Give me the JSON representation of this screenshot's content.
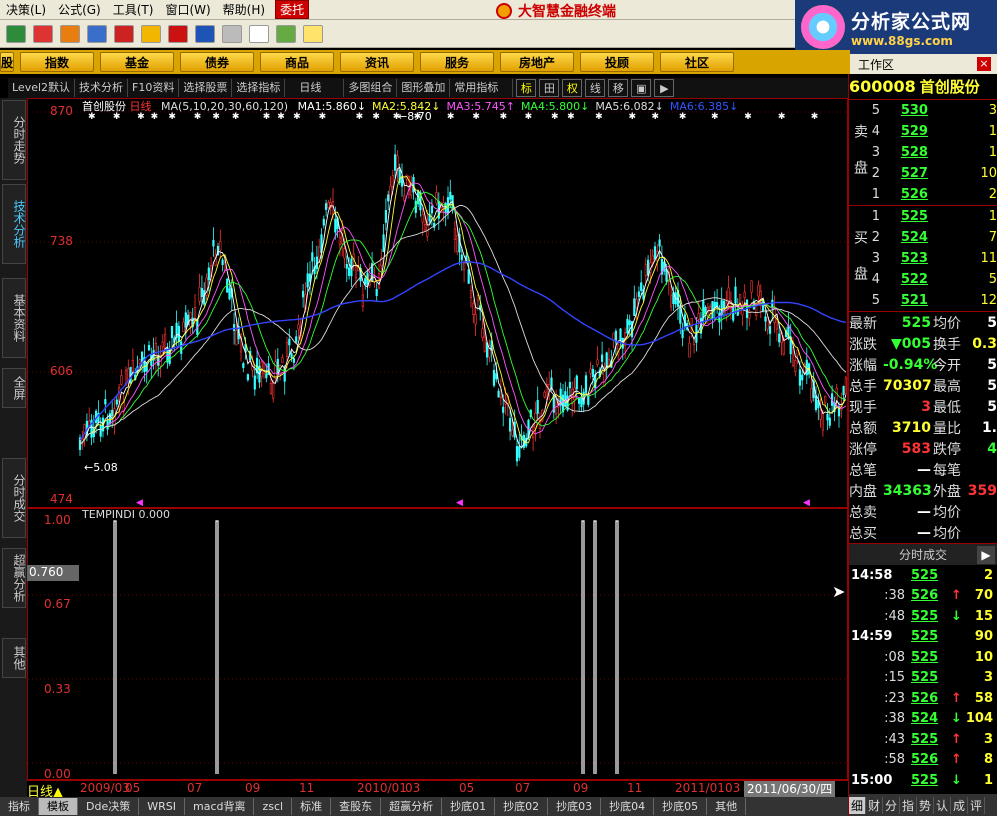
{
  "menu": {
    "items": [
      "决策(L)",
      "公式(G)",
      "工具(T)",
      "窗口(W)",
      "帮助(H)"
    ],
    "trade_label": "委托",
    "app_title": "大智慧金融终端"
  },
  "brand": {
    "name": "分析家公式网",
    "url": "www.88gs.com"
  },
  "section_nav": [
    "股",
    "指数",
    "基金",
    "债券",
    "商品",
    "资讯",
    "服务",
    "房地产",
    "投顾",
    "社区"
  ],
  "workarea_label": "工作区",
  "chart_toolbar": {
    "items": [
      "Level2默认",
      "技术分析",
      "F10资料",
      "选择股票",
      "选择指标",
      "日线",
      "多图组合",
      "图形叠加",
      "常用指标"
    ],
    "buttons": [
      "标",
      "田",
      "权",
      "线",
      "移"
    ]
  },
  "left_tabs": [
    "分时走势",
    "技术分析",
    "基本资料",
    "全屏",
    "分时成交",
    "超赢分析",
    "其他"
  ],
  "price_header": {
    "name": "首创股份",
    "period": "日线",
    "ma_label": "MA(5,10,20,30,60,120)",
    "ma": [
      {
        "label": "MA1:",
        "value": "5.860",
        "arrow": "↓",
        "color": "#ffffff"
      },
      {
        "label": "MA2:",
        "value": "5.842",
        "arrow": "↓",
        "color": "#ffff33"
      },
      {
        "label": "MA3:",
        "value": "5.745",
        "arrow": "↑",
        "color": "#ff55ff"
      },
      {
        "label": "MA4:",
        "value": "5.800",
        "arrow": "↓",
        "color": "#33ff33"
      },
      {
        "label": "MA5:",
        "value": "6.082",
        "arrow": "↓",
        "color": "#dddddd"
      },
      {
        "label": "MA6:",
        "value": "6.385",
        "arrow": "↓",
        "color": "#3355ff"
      }
    ]
  },
  "price_axis": [
    "870",
    "738",
    "606",
    "474"
  ],
  "price_annotations": {
    "high": "8.70",
    "low": "5.08"
  },
  "indicator": {
    "name": "TEMPINDI",
    "value": "0.000",
    "axis": [
      "1.00",
      "0.67",
      "0.33",
      "0.00"
    ],
    "cursor_value": "0.760"
  },
  "date_strip": {
    "period_label": "日线",
    "dates": [
      "2009/03",
      "05",
      "07",
      "09",
      "11",
      "2010/01",
      "03",
      "05",
      "07",
      "09",
      "11",
      "2011/01",
      "03"
    ],
    "cursor_date": "2011/06/30/四"
  },
  "bottom_tabs": [
    "指标",
    "模板",
    "Dde决策",
    "WRSI",
    "macd背离",
    "zscl",
    "标准",
    "查股东",
    "超赢分析",
    "抄底01",
    "抄底02",
    "抄底03",
    "抄底04",
    "抄底05",
    "其他"
  ],
  "stock": {
    "code": "600008",
    "name": "首创股份"
  },
  "order_book": {
    "sell_label": "卖盘",
    "buy_label": "买盘",
    "sell": [
      {
        "level": "5",
        "price": "530",
        "vol": "3"
      },
      {
        "level": "4",
        "price": "529",
        "vol": "1"
      },
      {
        "level": "3",
        "price": "528",
        "vol": "1"
      },
      {
        "level": "2",
        "price": "527",
        "vol": "10"
      },
      {
        "level": "1",
        "price": "526",
        "vol": "2"
      }
    ],
    "buy": [
      {
        "level": "1",
        "price": "525",
        "vol": "1"
      },
      {
        "level": "2",
        "price": "524",
        "vol": "7"
      },
      {
        "level": "3",
        "price": "523",
        "vol": "11"
      },
      {
        "level": "4",
        "price": "522",
        "vol": "5"
      },
      {
        "level": "5",
        "price": "521",
        "vol": "12"
      }
    ]
  },
  "quote": [
    {
      "k": "最新",
      "v": "525",
      "vc": "#33ff33",
      "k2": "均价",
      "v2": "5",
      "v2c": "#ffffff"
    },
    {
      "k": "涨跌",
      "v": "▼005",
      "vc": "#33ff33",
      "k2": "换手",
      "v2": "0.3",
      "v2c": "#ffff33"
    },
    {
      "k": "涨幅",
      "v": "-0.94%",
      "vc": "#33ff33",
      "k2": "今开",
      "v2": "5",
      "v2c": "#ffffff"
    },
    {
      "k": "总手",
      "v": "70307",
      "vc": "#ffff33",
      "k2": "最高",
      "v2": "5",
      "v2c": "#ffffff"
    },
    {
      "k": "现手",
      "v": "3",
      "vc": "#ff3333",
      "k2": "最低",
      "v2": "5",
      "v2c": "#ffffff"
    },
    {
      "k": "总额",
      "v": "3710",
      "vc": "#ffff33",
      "k2": "量比",
      "v2": "1.",
      "v2c": "#ffffff"
    },
    {
      "k": "涨停",
      "v": "583",
      "vc": "#ff3333",
      "k2": "跌停",
      "v2": "4",
      "v2c": "#33ff33"
    },
    {
      "k": "总笔",
      "v": "—",
      "vc": "#ffffff",
      "k2": "每笔",
      "v2": "",
      "v2c": "#ffffff"
    },
    {
      "k": "内盘",
      "v": "34363",
      "vc": "#33ff33",
      "k2": "外盘",
      "v2": "359",
      "v2c": "#ff3333"
    },
    {
      "k": "总卖",
      "v": "—",
      "vc": "#ffffff",
      "k2": "均价",
      "v2": "",
      "v2c": "#ffffff"
    },
    {
      "k": "总买",
      "v": "—",
      "vc": "#ffffff",
      "k2": "均价",
      "v2": "",
      "v2c": "#ffffff"
    }
  ],
  "trades_header": "分时成交",
  "trades": [
    {
      "t": "14:58",
      "big": true,
      "p": "525",
      "a": "",
      "ac": "#ff3333",
      "v": "2"
    },
    {
      "t": ":38",
      "big": false,
      "p": "526",
      "a": "↑",
      "ac": "#ff3333",
      "v": "70"
    },
    {
      "t": ":48",
      "big": false,
      "p": "525",
      "a": "↓",
      "ac": "#33ff33",
      "v": "15"
    },
    {
      "t": "14:59",
      "big": true,
      "p": "525",
      "a": "",
      "ac": "#ff3333",
      "v": "90"
    },
    {
      "t": ":08",
      "big": false,
      "p": "525",
      "a": "",
      "ac": "#ff3333",
      "v": "10"
    },
    {
      "t": ":15",
      "big": false,
      "p": "525",
      "a": "",
      "ac": "#ff3333",
      "v": "3"
    },
    {
      "t": ":23",
      "big": false,
      "p": "526",
      "a": "↑",
      "ac": "#ff3333",
      "v": "58"
    },
    {
      "t": ":38",
      "big": false,
      "p": "524",
      "a": "↓",
      "ac": "#33ff33",
      "v": "104"
    },
    {
      "t": ":43",
      "big": false,
      "p": "525",
      "a": "↑",
      "ac": "#ff3333",
      "v": "3"
    },
    {
      "t": ":58",
      "big": false,
      "p": "526",
      "a": "↑",
      "ac": "#ff3333",
      "v": "8"
    },
    {
      "t": "15:00",
      "big": true,
      "p": "525",
      "a": "↓",
      "ac": "#33ff33",
      "v": "1"
    }
  ],
  "right_bottom_tabs": [
    "细",
    "财",
    "分",
    "指",
    "势",
    "认",
    "成",
    "评"
  ]
}
